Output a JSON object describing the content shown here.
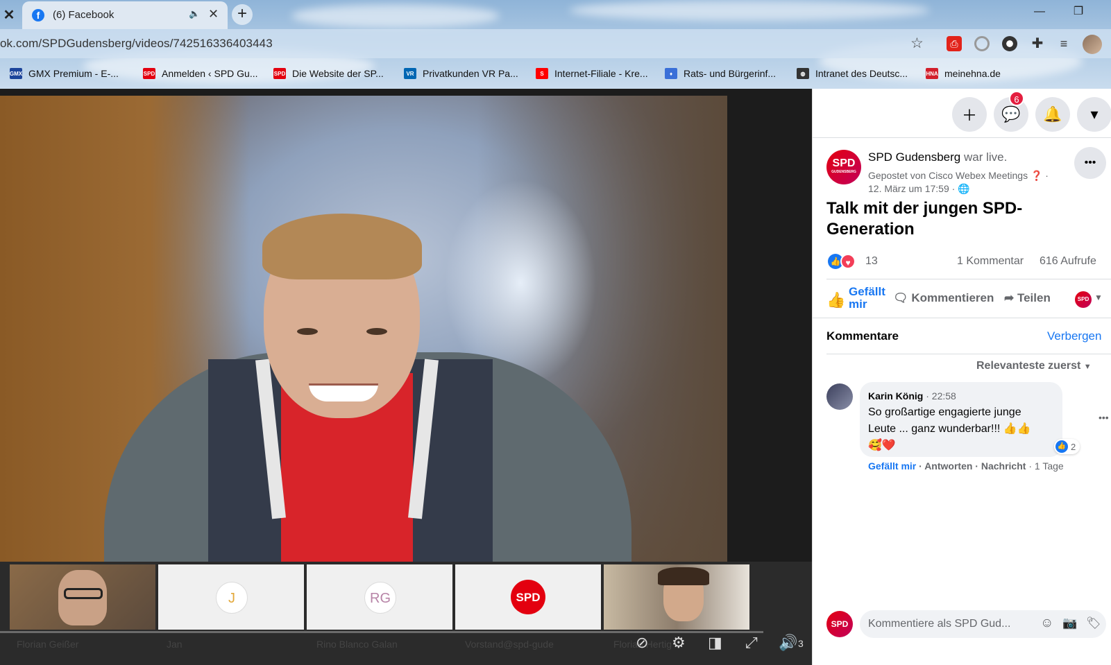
{
  "browser": {
    "tab_close_left": "✕",
    "tab": {
      "title": "(6) Facebook",
      "close": "✕"
    },
    "new_tab": "+",
    "window": {
      "minimize": "—",
      "restore": "❐",
      "close": "✕"
    },
    "url": "ok.com/SPDGudensberg/videos/742516336403443",
    "bookmarks": [
      {
        "label": "GMX Premium - E-...",
        "icon": "GMX",
        "color": "#1c449b"
      },
      {
        "label": "Anmelden ‹ SPD Gu...",
        "icon": "SPD",
        "color": "#e3000f"
      },
      {
        "label": "Die Website der SP...",
        "icon": "SPD",
        "color": "#e3000f"
      },
      {
        "label": "Privatkunden VR Pa...",
        "icon": "VR",
        "color": "#0066b3"
      },
      {
        "label": "Internet-Filiale - Kre...",
        "icon": "S",
        "color": "#ff0000"
      },
      {
        "label": "Rats- und Bürgerinf...",
        "icon": "♦",
        "color": "#3a6fd8"
      },
      {
        "label": "Intranet des Deutsc...",
        "icon": "◍",
        "color": "#333333"
      },
      {
        "label": "meinehna.de",
        "icon": "HNA",
        "color": "#d21f2b"
      }
    ]
  },
  "video": {
    "participants": [
      {
        "name": "Florian Geißer",
        "initials": ""
      },
      {
        "name": "Jan",
        "initials": "J"
      },
      {
        "name": "Rino Blanco Galan",
        "initials": "RG"
      },
      {
        "name": "Vorstand@spd-gude",
        "initials": "SPD"
      },
      {
        "name": "Florian Hertig",
        "initials": ""
      }
    ],
    "volume_count": "3"
  },
  "facebook": {
    "messenger_badge": "6",
    "page_name": "SPD Gudensberg",
    "status": "war live.",
    "posted_by": "Gepostet von Cisco Webex Meetings",
    "date": "12. März um 17:59 ·",
    "post_title_line1": "Talk mit der jungen SPD-",
    "post_title_line2": "Generation",
    "reaction_count": "13",
    "comment_count": "1 Kommentar",
    "views": "616 Aufrufe",
    "actions": {
      "like_line1": "Gefällt",
      "like_line2": "mir",
      "comment": "Kommentieren",
      "share": "Teilen"
    },
    "comments_heading": "Kommentare",
    "hide": "Verbergen",
    "sort": "Relevanteste zuerst",
    "comment": {
      "author": "Karin König",
      "time": "22:58",
      "text_line1": "So großartige engagierte junge",
      "text_line2": "Leute ... ganz wunderbar!!! 👍👍",
      "text_line3": "🥰❤️",
      "likes": "2",
      "like": "Gefällt mir",
      "reply": "Antworten",
      "message": "Nachricht",
      "age": "1 Tage"
    },
    "compose_placeholder": "Kommentiere als SPD Gud...",
    "logo_text": "SPD",
    "logo_sub": "GUDENSBERG"
  }
}
